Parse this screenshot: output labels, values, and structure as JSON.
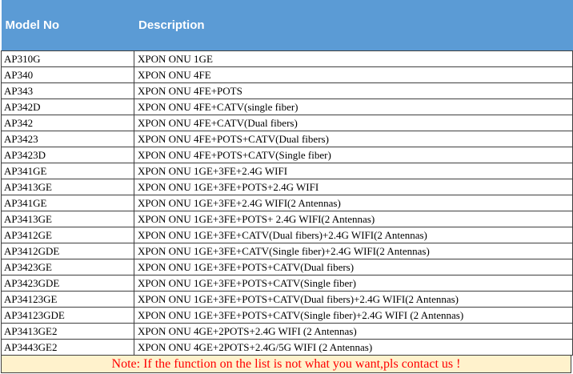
{
  "header": {
    "model_label": "Model No",
    "description_label": "Description"
  },
  "rows": [
    {
      "model": "AP310G",
      "description": "XPON ONU 1GE"
    },
    {
      "model": "AP340",
      "description": "XPON ONU 4FE"
    },
    {
      "model": "AP343",
      "description": "XPON ONU 4FE+POTS"
    },
    {
      "model": "AP342D",
      "description": "XPON ONU 4FE+CATV(single fiber)"
    },
    {
      "model": "AP342",
      "description": "XPON ONU 4FE+CATV(Dual fibers)"
    },
    {
      "model": "AP3423",
      "description": "XPON ONU 4FE+POTS+CATV(Dual fibers)"
    },
    {
      "model": "AP3423D",
      "description": "XPON ONU 4FE+POTS+CATV(Single fiber)"
    },
    {
      "model": "AP341GE",
      "description": "XPON ONU 1GE+3FE+2.4G WIFI"
    },
    {
      "model": "AP3413GE",
      "description": "XPON ONU 1GE+3FE+POTS+2.4G WIFI"
    },
    {
      "model": "AP341GE",
      "description": "XPON ONU 1GE+3FE+2.4G WIFI(2 Antennas)"
    },
    {
      "model": "AP3413GE",
      "description": "XPON ONU 1GE+3FE+POTS+ 2.4G WIFI(2 Antennas)"
    },
    {
      "model": "AP3412GE",
      "description": "XPON ONU 1GE+3FE+CATV(Dual fibers)+2.4G WIFI(2 Antennas)"
    },
    {
      "model": "AP3412GDE",
      "description": "XPON ONU 1GE+3FE+CATV(Single fiber)+2.4G WIFI(2 Antennas)"
    },
    {
      "model": "AP3423GE",
      "description": "XPON ONU 1GE+3FE+POTS+CATV(Dual fibers)"
    },
    {
      "model": "AP3423GDE",
      "description": "XPON ONU 1GE+3FE+POTS+CATV(Single fiber)"
    },
    {
      "model": "AP34123GE",
      "description": "XPON ONU 1GE+3FE+POTS+CATV(Dual fibers)+2.4G WIFI(2 Antennas)"
    },
    {
      "model": "AP34123GDE",
      "description": "XPON ONU 1GE+3FE+POTS+CATV(Single fiber)+2.4G WIFI (2 Antennas)"
    },
    {
      "model": "AP3413GE2",
      "description": "XPON ONU 4GE+2POTS+2.4G WIFI (2 Antennas)"
    },
    {
      "model": "AP3443GE2",
      "description": "XPON ONU 4GE+2POTS+2.4G/5G WIFI (2 Antennas)"
    }
  ],
  "note": "Note: If the function on the list is not what you want,pls contact us !",
  "colors": {
    "header_bg": "#5b9bd5",
    "header_text": "#ffffff",
    "note_bg": "#fff2cc",
    "note_text": "#ff0000",
    "grid_line": "#3f3f3f"
  }
}
